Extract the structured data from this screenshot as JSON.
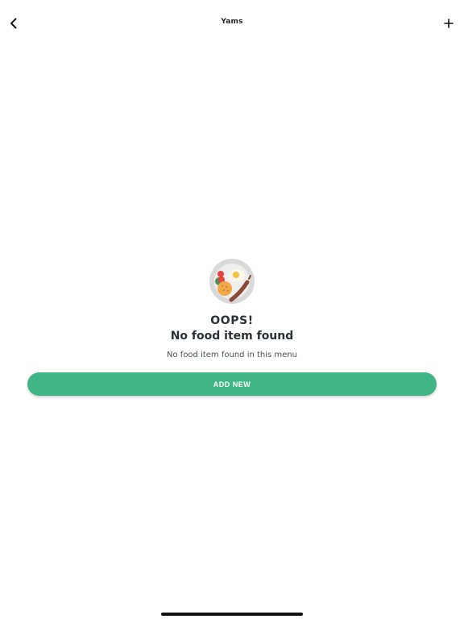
{
  "nav": {
    "title": "Yams",
    "back_icon": "chevron-left-icon",
    "add_icon": "plus-icon"
  },
  "empty_state": {
    "illustration_icon": "food-plate-icon",
    "oops": "OOPS!",
    "heading": "No food item found",
    "subtitle": "No food item found in this menu"
  },
  "actions": {
    "add_new_label": "ADD NEW"
  },
  "colors": {
    "accent": "#41b585",
    "plate": "#d9d9d9",
    "text": "#2b2f36"
  }
}
